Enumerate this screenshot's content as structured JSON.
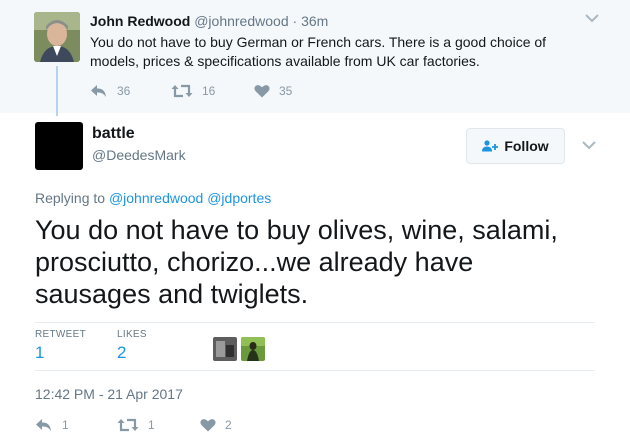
{
  "parent": {
    "name": "John Redwood",
    "handle": "@johnredwood",
    "separator": "·",
    "time": "36m",
    "text": "You do not have to buy German or French cars. There is a good choice of models, prices & specifications available from  UK car factories.",
    "replies": "36",
    "retweets": "16",
    "likes": "35"
  },
  "tweet": {
    "name": "battle",
    "handle": "@DeedesMark",
    "follow_label": "Follow",
    "replying_prefix": "Replying to",
    "replying_to": [
      "@johnredwood",
      "@jdportes"
    ],
    "text": "You do not have to buy olives, wine, salami, prosciutto, chorizo...we already have sausages and twiglets.",
    "stats": {
      "retweets_label": "RETWEET",
      "retweets": "1",
      "likes_label": "LIKES",
      "likes": "2"
    },
    "timestamp": "12:42 PM - 21 Apr 2017",
    "actions": {
      "replies": "1",
      "retweets": "1",
      "likes": "2"
    }
  },
  "colors": {
    "link": "#1b95e0",
    "muted": "#657786",
    "action": "#8899a6",
    "parent_bg": "#f5f8fa",
    "thread_line": "#b5d3ec"
  },
  "icons": [
    "reply-icon",
    "retweet-icon",
    "heart-icon",
    "chevron-down-icon",
    "follow-person-icon"
  ]
}
